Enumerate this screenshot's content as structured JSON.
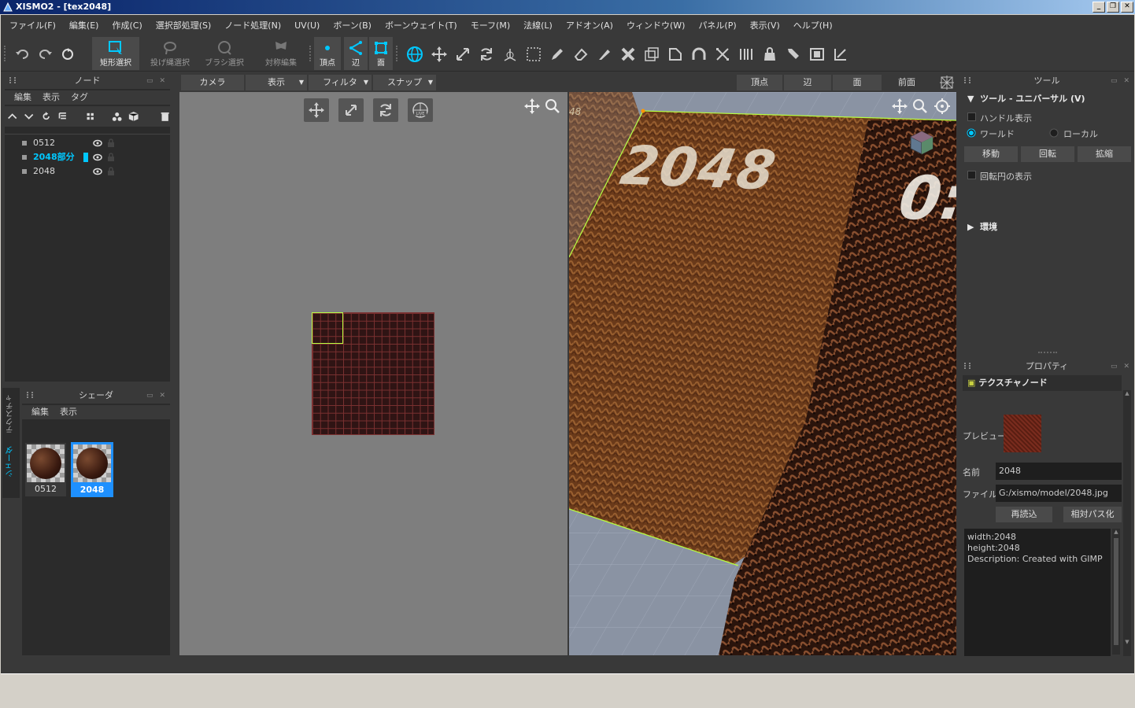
{
  "window": {
    "title": "XISMO2 - [tex2048]"
  },
  "menu": [
    "ファイル(F)",
    "編集(E)",
    "作成(C)",
    "選択部処理(S)",
    "ノード処理(N)",
    "UV(U)",
    "ボーン(B)",
    "ボーンウェイト(T)",
    "モーフ(M)",
    "法線(L)",
    "アドオン(A)",
    "ウィンドウ(W)",
    "パネル(P)",
    "表示(V)",
    "ヘルプ(H)"
  ],
  "toolbar": {
    "rect_select": "矩形選択",
    "lasso_select": "投げ縄選択",
    "brush_select": "ブラシ選択",
    "symmetric_edit": "対称編集",
    "vertex": "頂点",
    "edge": "辺",
    "face": "面"
  },
  "node_panel": {
    "title": "ノード",
    "menu": [
      "編集",
      "表示",
      "タグ"
    ],
    "items": [
      "0512",
      "2048部分",
      "2048"
    ],
    "selected": "2048部分"
  },
  "shader_panel": {
    "title": "シェーダ",
    "menu": [
      "編集",
      "表示"
    ],
    "items": [
      "0512",
      "2048"
    ],
    "selected": "2048",
    "side_tabs": [
      "テクスチャ",
      "シェーダ"
    ]
  },
  "uv_tabs": {
    "camera": "カメラ",
    "view": "表示",
    "filter": "フィルタ",
    "snap": "スナップ"
  },
  "view_tabs": {
    "vertex": "頂点",
    "edge": "辺",
    "face": "面",
    "front": "前面"
  },
  "viewport": {
    "texture_label_1": "2048",
    "texture_label_2": "0:",
    "corner_label": "48"
  },
  "tool_panel": {
    "title": "ツール",
    "section": "ツール - ユニバーサル (V)",
    "handle_display": "ハンドル表示",
    "world": "ワールド",
    "local": "ローカル",
    "move": "移動",
    "rotate": "回転",
    "scale": "拡縮",
    "rotation_circle": "回転円の表示",
    "environment": "環境"
  },
  "property_panel": {
    "title": "プロパティ",
    "node_type": "テクスチャノード",
    "preview_label": "プレビュー",
    "name_label": "名前",
    "name_value": "2048",
    "file_label": "ファイル",
    "file_value": "G:/xismo/model/2048.jpg",
    "reload": "再読込",
    "relative_path": "相対パス化",
    "info_width": "width:2048",
    "info_height": "height:2048",
    "info_desc": "Description: Created with GIMP"
  },
  "colors": {
    "accent": "#00c8ff",
    "selection_green": "#b8ff40",
    "panel_bg": "#2b2b2b"
  }
}
